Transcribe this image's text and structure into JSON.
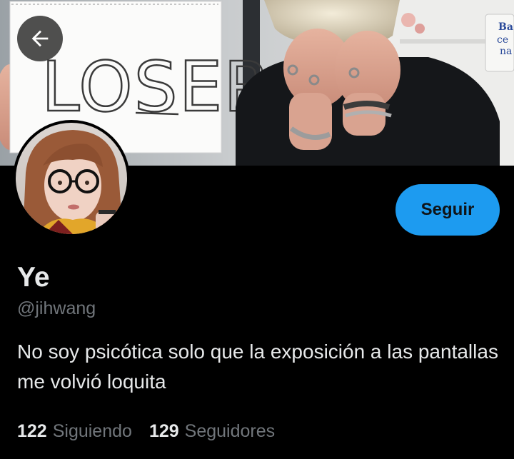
{
  "banner": {
    "sign_text": "LOSER",
    "corner_text": "Ba ce na"
  },
  "header": {
    "back_icon": "arrow-left-icon"
  },
  "profile": {
    "display_name": "Ye",
    "handle": "@jihwang",
    "bio": "No soy psicótica solo que la exposición a las pantallas me volvió loquita",
    "follow_label": "Seguir",
    "following_count": "122",
    "following_label": "Siguiendo",
    "followers_count": "129",
    "followers_label": "Seguidores"
  },
  "colors": {
    "background": "#000000",
    "accent": "#1d9bf0",
    "primary_text": "#e7e9ea",
    "secondary_text": "#71767b"
  }
}
